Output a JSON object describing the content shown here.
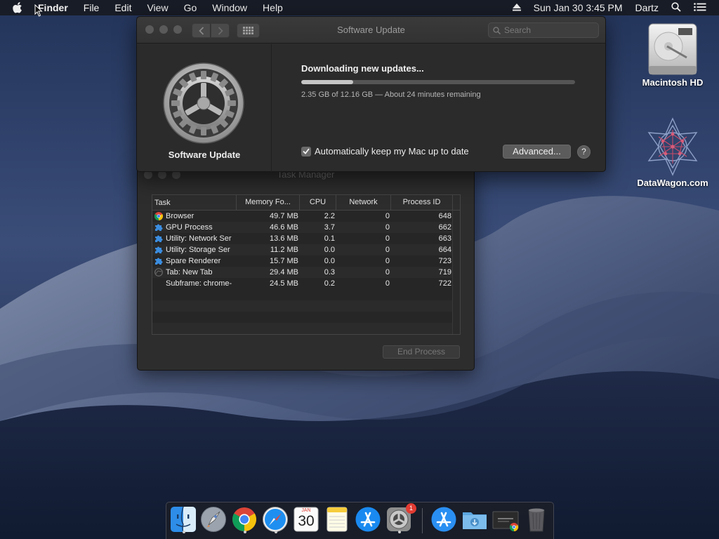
{
  "menubar": {
    "app_name": "Finder",
    "menus": [
      "File",
      "Edit",
      "View",
      "Go",
      "Window",
      "Help"
    ],
    "datetime": "Sun Jan 30  3:45 PM",
    "user": "Dartz"
  },
  "software_update": {
    "window_title": "Software Update",
    "search_placeholder": "Search",
    "pane_name": "Software Update",
    "status": "Downloading new updates...",
    "progress": 0.19,
    "detail": "2.35 GB of 12.16 GB — About 24 minutes remaining",
    "auto_update_label": "Automatically keep my Mac up to date",
    "auto_update_checked": true,
    "advanced_label": "Advanced...",
    "help_label": "?"
  },
  "task_manager": {
    "window_title": "Task Manager",
    "columns": [
      "Task",
      "Memory Fo...",
      "CPU",
      "Network",
      "Process ID"
    ],
    "rows": [
      {
        "task": "Browser",
        "icon": "chrome-icon",
        "memory": "49.7 MB",
        "cpu": "2.2",
        "network": "0",
        "pid": "648"
      },
      {
        "task": "GPU Process",
        "icon": "puzzle-icon",
        "memory": "46.6 MB",
        "cpu": "3.7",
        "network": "0",
        "pid": "662"
      },
      {
        "task": "Utility: Network Ser",
        "icon": "puzzle-icon",
        "memory": "13.6 MB",
        "cpu": "0.1",
        "network": "0",
        "pid": "663"
      },
      {
        "task": "Utility: Storage Ser",
        "icon": "puzzle-icon",
        "memory": "11.2 MB",
        "cpu": "0.0",
        "network": "0",
        "pid": "664"
      },
      {
        "task": "Spare Renderer",
        "icon": "puzzle-icon",
        "memory": "15.7 MB",
        "cpu": "0.0",
        "network": "0",
        "pid": "723"
      },
      {
        "task": "Tab: New Tab",
        "icon": "globe-icon",
        "memory": "29.4 MB",
        "cpu": "0.3",
        "network": "0",
        "pid": "719"
      },
      {
        "task": "Subframe: chrome-",
        "icon": "",
        "memory": "24.5 MB",
        "cpu": "0.2",
        "network": "0",
        "pid": "722"
      }
    ],
    "end_process_label": "End Process"
  },
  "desktop_icons": [
    {
      "label": "Macintosh HD",
      "icon": "hard-drive-icon"
    },
    {
      "label": "DataWagon.com",
      "icon": "geometric-star-icon"
    }
  ],
  "dock": {
    "calendar_month": "JAN",
    "calendar_day": "30",
    "system_preferences_badge": "1",
    "items": [
      "finder-icon",
      "launchpad-icon",
      "chrome-icon",
      "safari-icon",
      "calendar-icon",
      "notes-icon",
      "app-store-icon",
      "system-preferences-icon",
      "app-store-icon",
      "downloads-folder-icon",
      "document-thumbnail-icon",
      "trash-icon"
    ]
  }
}
